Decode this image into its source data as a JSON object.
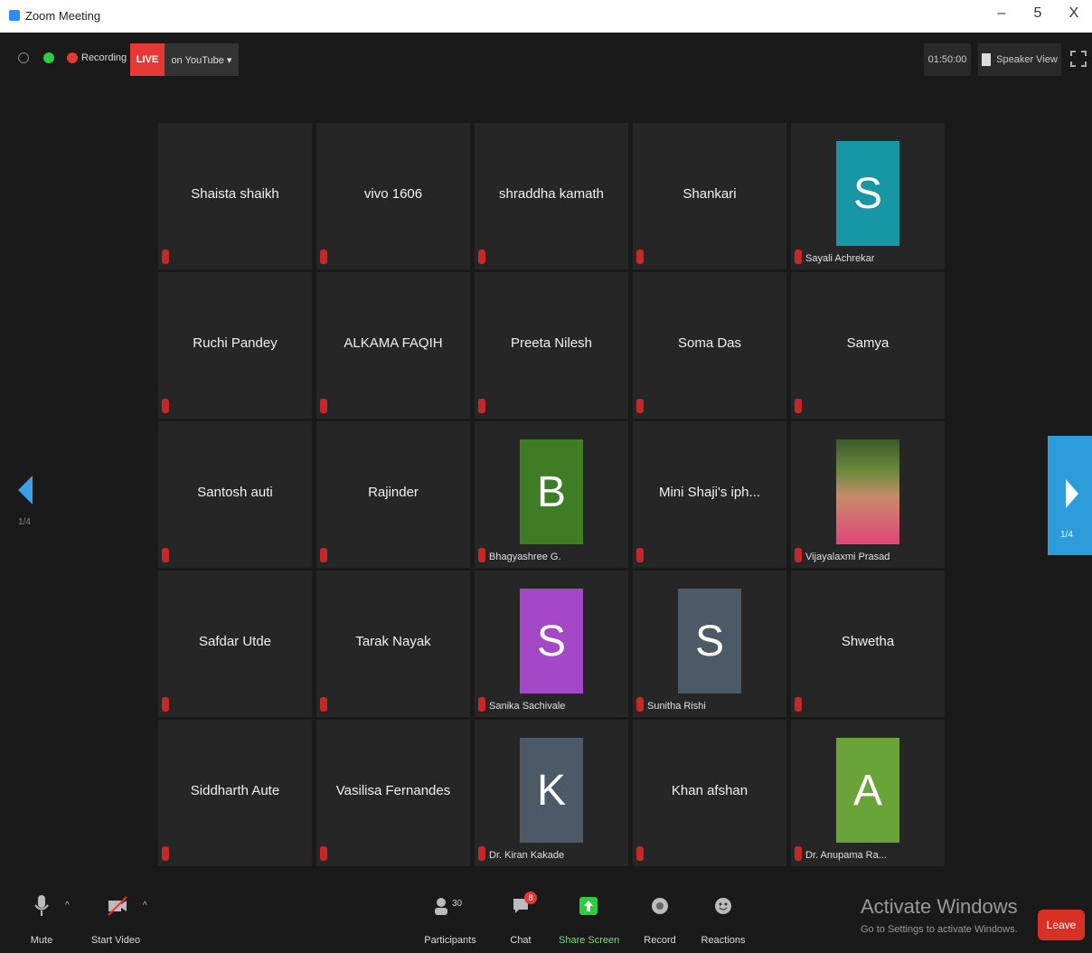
{
  "window": {
    "title": "Zoom Meeting",
    "controls": [
      "–",
      "5",
      "X"
    ]
  },
  "topbar": {
    "recording_label": "Recording",
    "live_label": "LIVE",
    "live_destination": "on YouTube ▾",
    "timer": "01:50:00",
    "view_label": "Speaker View"
  },
  "pager": {
    "left_page": "1/4",
    "right_page": "1/4"
  },
  "participants": [
    {
      "name": "Shaista shaikh",
      "avatar_letter": "",
      "avatar_color": ""
    },
    {
      "name": "vivo 1606",
      "avatar_letter": "",
      "avatar_color": ""
    },
    {
      "name": "shraddha kamath",
      "avatar_letter": "",
      "avatar_color": ""
    },
    {
      "name": "Shankari",
      "avatar_letter": "",
      "avatar_color": ""
    },
    {
      "name": "Sayali Achrekar",
      "avatar_letter": "S",
      "avatar_color": "#1797a6"
    },
    {
      "name": "Ruchi Pandey",
      "avatar_letter": "",
      "avatar_color": ""
    },
    {
      "name": "ALKAMA FAQIH",
      "avatar_letter": "",
      "avatar_color": ""
    },
    {
      "name": "Preeta Nilesh",
      "avatar_letter": "",
      "avatar_color": ""
    },
    {
      "name": "Soma Das",
      "avatar_letter": "",
      "avatar_color": ""
    },
    {
      "name": "Samya",
      "avatar_letter": "",
      "avatar_color": ""
    },
    {
      "name": "Santosh auti",
      "avatar_letter": "",
      "avatar_color": ""
    },
    {
      "name": "Rajinder",
      "avatar_letter": "",
      "avatar_color": ""
    },
    {
      "name": "Bhagyashree G.",
      "avatar_letter": "B",
      "avatar_color": "#3e7d26"
    },
    {
      "name": "Mini Shaji's iph...",
      "avatar_letter": "",
      "avatar_color": ""
    },
    {
      "name": "Vijayalaxmi Prasad",
      "avatar_letter": "photo",
      "avatar_color": ""
    },
    {
      "name": "Safdar Utde",
      "avatar_letter": "",
      "avatar_color": ""
    },
    {
      "name": "Tarak Nayak",
      "avatar_letter": "",
      "avatar_color": ""
    },
    {
      "name": "Sanika Sachivale",
      "avatar_letter": "S",
      "avatar_color": "#a548c8"
    },
    {
      "name": "Sunitha Rishi",
      "avatar_letter": "S",
      "avatar_color": "#4b5a66"
    },
    {
      "name": "Shwetha",
      "avatar_letter": "",
      "avatar_color": ""
    },
    {
      "name": "Siddharth Aute",
      "avatar_letter": "",
      "avatar_color": ""
    },
    {
      "name": "Vasilisa Fernandes",
      "avatar_letter": "",
      "avatar_color": ""
    },
    {
      "name": "Dr. Kiran Kakade",
      "avatar_letter": "K",
      "avatar_color": "#4b5a66"
    },
    {
      "name": "Khan afshan",
      "avatar_letter": "",
      "avatar_color": ""
    },
    {
      "name": "Dr. Anupama Ra...",
      "avatar_letter": "A",
      "avatar_color": "#6aa33a"
    }
  ],
  "toolbar": {
    "mute": "Mute",
    "start_video": "Start Video",
    "participants": "Participants",
    "participants_count": "30",
    "chat": "Chat",
    "chat_badge": "8",
    "share_screen": "Share Screen",
    "record": "Record",
    "reactions": "Reactions",
    "leave": "Leave"
  },
  "watermark": {
    "line1": "Activate Windows",
    "line2": "Go to Settings to activate Windows."
  },
  "colors": {
    "live": "#e53935",
    "share": "#2ecc40",
    "leave": "#d93025",
    "nav": "#2d9cdb"
  }
}
